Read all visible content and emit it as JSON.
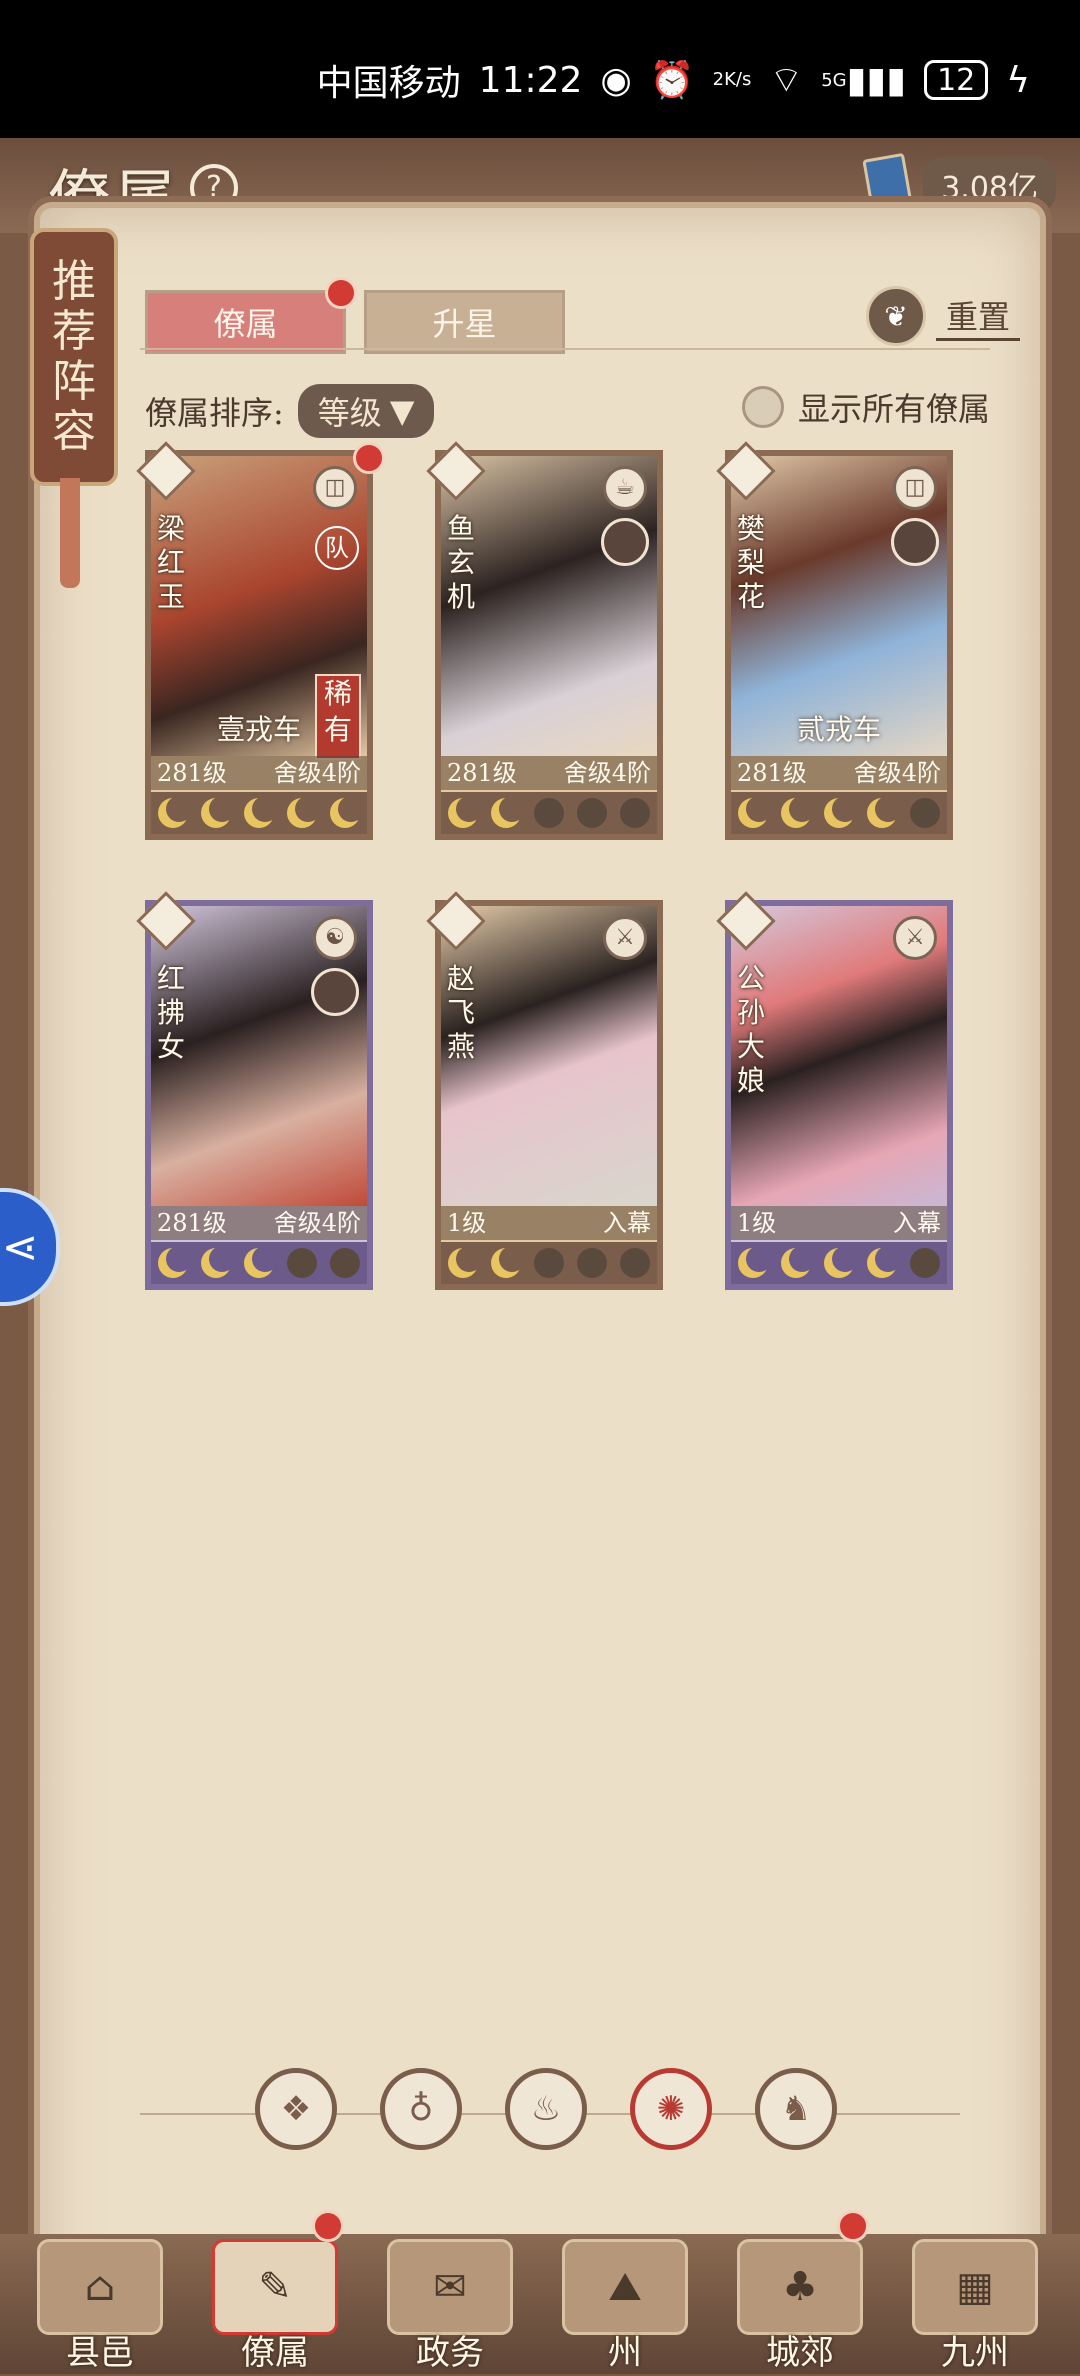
{
  "status_bar": {
    "carrier": "中国移动",
    "time": "11:22",
    "net_speed_value": "2",
    "net_speed_unit": "K/s",
    "signal": "5G",
    "battery": "12"
  },
  "header": {
    "title": "僚属",
    "currency_value": "3.08亿"
  },
  "recommend_banner": [
    "推",
    "荐",
    "阵",
    "容"
  ],
  "tabs": [
    {
      "label": "僚属",
      "active": true
    },
    {
      "label": "升星",
      "active": false
    }
  ],
  "reset_label": "重置",
  "sort": {
    "label": "僚属排序:",
    "value": "等级"
  },
  "show_all_label": "显示所有僚属",
  "cards": [
    {
      "name": "梁红玉",
      "level": "281级",
      "rank": "舍级4阶",
      "title": "壹戎车",
      "rare": "稀有",
      "badge": "队",
      "stars_on": 5,
      "frame": "brown"
    },
    {
      "name": "鱼玄机",
      "level": "281级",
      "rank": "舍级4阶",
      "title": "",
      "rare": "",
      "badge": "",
      "stars_on": 2,
      "frame": "brown"
    },
    {
      "name": "樊梨花",
      "level": "281级",
      "rank": "舍级4阶",
      "title": "贰戎车",
      "rare": "",
      "badge": "",
      "stars_on": 4,
      "frame": "brown"
    },
    {
      "name": "红拂女",
      "level": "281级",
      "rank": "舍级4阶",
      "title": "",
      "rare": "",
      "badge": "",
      "stars_on": 3,
      "frame": "purple"
    },
    {
      "name": "赵飞燕",
      "level": "1级",
      "rank": "入幕",
      "title": "",
      "rare": "",
      "badge": "",
      "stars_on": 2,
      "frame": "brown"
    },
    {
      "name": "公孙大娘",
      "level": "1级",
      "rank": "入幕",
      "title": "",
      "rare": "",
      "badge": "",
      "stars_on": 4,
      "frame": "purple"
    }
  ],
  "filters": [
    {
      "icon": "diamond-icon",
      "glyph": "❖",
      "active": false
    },
    {
      "icon": "bell-icon",
      "glyph": "♁",
      "active": false
    },
    {
      "icon": "gourd-icon",
      "glyph": "♨",
      "active": false
    },
    {
      "icon": "fan-icon",
      "glyph": "✺",
      "active": true
    },
    {
      "icon": "beast-icon",
      "glyph": "♞",
      "active": false
    }
  ],
  "bottom_nav": [
    {
      "label": "县邑",
      "glyph": "⌂"
    },
    {
      "label": "僚属",
      "glyph": "✎"
    },
    {
      "label": "政务",
      "glyph": "✉"
    },
    {
      "label": "州",
      "glyph": "⛰"
    },
    {
      "label": "城郊",
      "glyph": "♣"
    },
    {
      "label": "九州",
      "glyph": "▦"
    }
  ],
  "colors": {
    "accent_red": "#d23a34",
    "tab_active": "#d77f7b",
    "paper": "#ecdfc8"
  }
}
